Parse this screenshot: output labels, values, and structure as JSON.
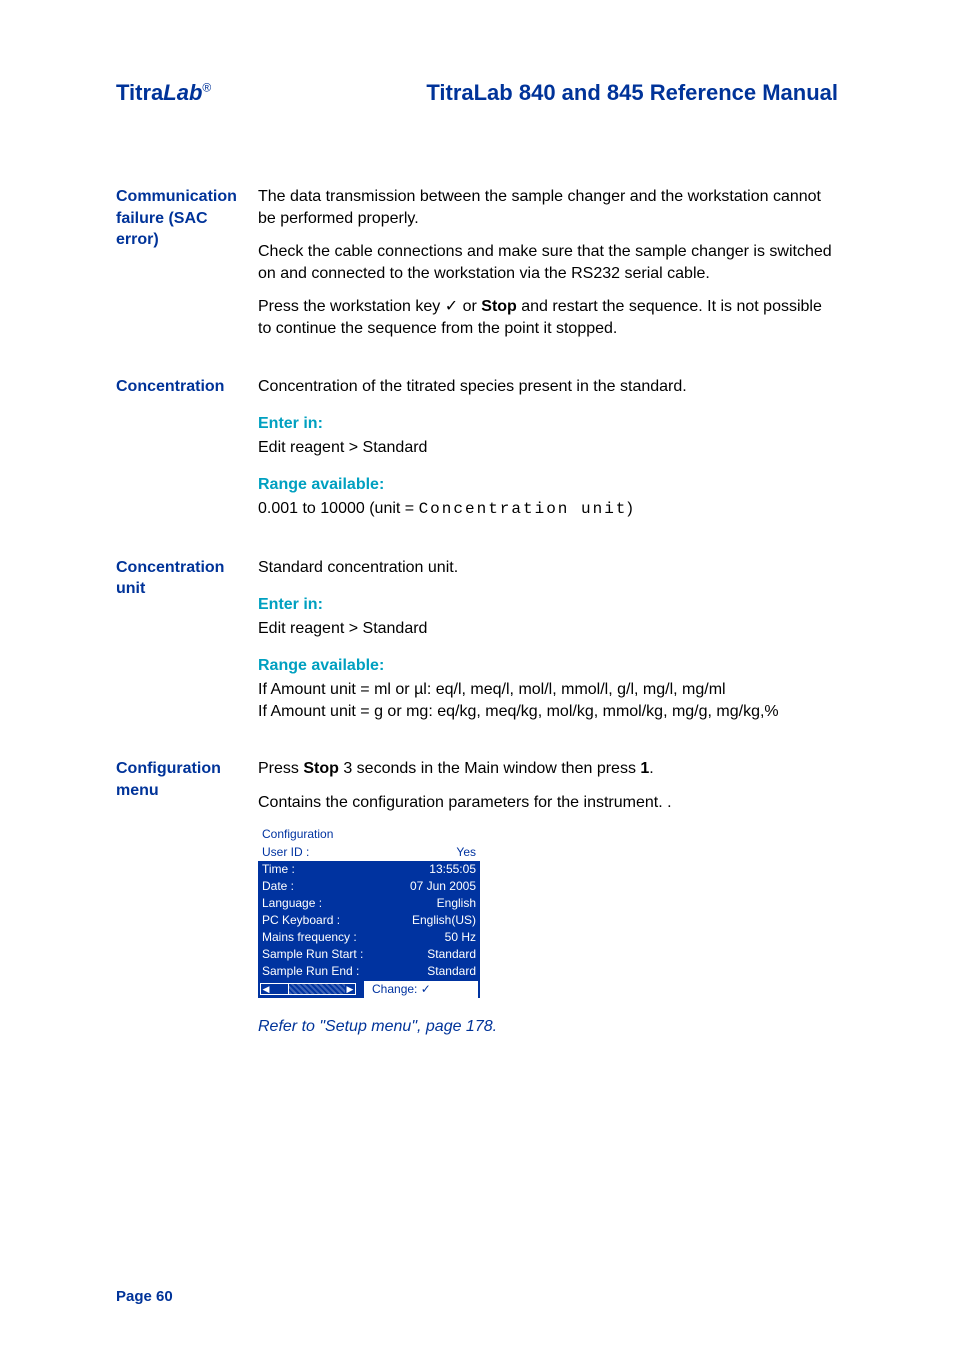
{
  "header": {
    "brand_prefix": "Titra",
    "brand_suffix": "Lab",
    "brand_reg": "®",
    "doc_title": "TitraLab 840 and 845 Reference Manual"
  },
  "entries": [
    {
      "label": "Communication failure (SAC error)",
      "paragraphs": [
        "The data transmission between the sample changer and the workstation cannot be performed properly.",
        "Check the cable connections and make sure that the sample changer is switched on and connected to the workstation via the RS232 serial cable."
      ],
      "press_prefix": "Press the workstation key ✓ or ",
      "press_strong": "Stop",
      "press_suffix": " and restart  the sequence. It is not possible to continue the sequence from the point it stopped."
    },
    {
      "label": "Concentration",
      "paragraphs": [
        "Concentration of the titrated species present in the standard."
      ],
      "enter_in_label": "Enter in:",
      "enter_in_text": "Edit reagent > Standard",
      "range_label": "Range available:",
      "range_prefix": "0.001 to 10000 (unit = ",
      "range_mono": "Concentration unit",
      "range_suffix": ")"
    },
    {
      "label": "Concentration unit",
      "paragraphs": [
        "Standard concentration unit."
      ],
      "enter_in_label": "Enter in:",
      "enter_in_text": "Edit reagent > Standard",
      "range_label": "Range available:",
      "range_text": "If Amount unit = ml or µl: eq/l, meq/l, mol/l, mmol/l, g/l, mg/l, mg/ml\nIf Amount unit = g or mg: eq/kg, meq/kg, mol/kg, mmol/kg, mg/g, mg/kg,%"
    },
    {
      "label": "Configuration menu",
      "press_prefix": "Press ",
      "press_strong1": "Stop",
      "press_mid": " 3 seconds in the Main window then press ",
      "press_strong2": "1",
      "press_suffix": ".",
      "paragraphs": [
        "Contains the configuration parameters for the instrument. ."
      ],
      "screenshot": {
        "title": "Configuration",
        "rows": [
          {
            "k": "User ID :",
            "v": "Yes",
            "selected": true
          },
          {
            "k": "Time :",
            "v": "13:55:05"
          },
          {
            "k": "Date :",
            "v": "07 Jun 2005"
          },
          {
            "k": "Language :",
            "v": "English"
          },
          {
            "k": "PC Keyboard :",
            "v": "English(US)"
          },
          {
            "k": "Mains frequency :",
            "v": "50 Hz"
          },
          {
            "k": "Sample Run Start :",
            "v": "Standard"
          },
          {
            "k": "Sample Run End :",
            "v": "Standard"
          }
        ],
        "footer_label": "Change: ✓"
      },
      "ref_link": "Refer to \"Setup menu\", page 178."
    }
  ],
  "footer": "Page 60"
}
